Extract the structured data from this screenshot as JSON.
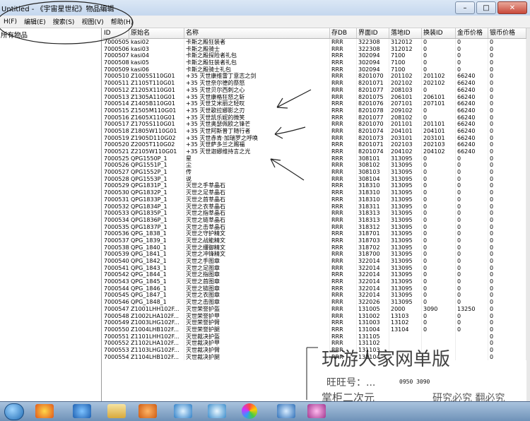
{
  "window": {
    "title": "Untitled - 《宇宙星世纪》物品编辑"
  },
  "menu": [
    "H(F)",
    "编辑(E)",
    "搜索(S)",
    "视图(V)",
    "帮助(H)"
  ],
  "tree": {
    "root_label": "所有物品"
  },
  "columns": [
    "ID",
    "原始名",
    "名称",
    "存DB",
    "界面ID",
    "落地ID",
    "换装ID",
    "金币价格",
    "银币价格"
  ],
  "rows": [
    [
      "7000505",
      "kasi02",
      "卡斯之殿狂装者",
      "RRR",
      "322308",
      "312012",
      "0",
      "0",
      "0"
    ],
    [
      "7000506",
      "kasi03",
      "卡斯之殿骑士",
      "RRR",
      "322308",
      "312012",
      "0",
      "0",
      "0"
    ],
    [
      "7000507",
      "kasi04",
      "卡斯之殿探险者礼包",
      "RRR",
      "302094",
      "7100",
      "0",
      "0",
      "0"
    ],
    [
      "7000508",
      "kasi05",
      "卡斯之殿狂装者礼包",
      "RRR",
      "302094",
      "7100",
      "0",
      "0",
      "0"
    ],
    [
      "7000509",
      "kasi06",
      "卡斯之殿骑士礼包",
      "RRR",
      "302094",
      "7100",
      "0",
      "0",
      "0"
    ],
    [
      "7000510",
      "Z1005S110G01",
      "+35 灭世康维雷丁意志之剑",
      "RRR",
      "8201070",
      "201102",
      "201102",
      "66240",
      "0"
    ],
    [
      "7000511",
      "Z1105T110G01",
      "+35 灭世奈尔德的祭怒",
      "RRR",
      "8201071",
      "202102",
      "202102",
      "66240",
      "0"
    ],
    [
      "7000512",
      "Z1205X110G01",
      "+35 灭世贝尔西刺之心",
      "RRR",
      "8201077",
      "208103",
      "0",
      "66240",
      "0"
    ],
    [
      "7000513",
      "Z1305A110G01",
      "+35 灭世康格狂怒之斩",
      "RRR",
      "8201075",
      "206101",
      "206101",
      "66240",
      "0"
    ],
    [
      "7000514",
      "Z1405B110G01",
      "+35 灭世艾米丽之轻叹",
      "RRR",
      "8201076",
      "207101",
      "207101",
      "66240",
      "0"
    ],
    [
      "7000515",
      "Z1505M110G01",
      "+35 灭世歌拉娜影之刃",
      "RRR",
      "8201078",
      "209102",
      "0",
      "66240",
      "0"
    ],
    [
      "7000516",
      "Z1605X110G01",
      "+35 灭世凯乐妮的微笑",
      "RRR",
      "8201077",
      "208102",
      "0",
      "66240",
      "0"
    ],
    [
      "7000517",
      "Z1705S110G01",
      "+35 灭世奥瑟佩欧之锋芒",
      "RRR",
      "8201070",
      "201101",
      "201101",
      "66240",
      "0"
    ],
    [
      "7000518",
      "Z1805W110G01",
      "+35 灭世阿斯普丁随行者",
      "RRR",
      "8201074",
      "204101",
      "204101",
      "66240",
      "0"
    ],
    [
      "7000519",
      "Z1905D110G02",
      "+35 灭世赤肯·加瑞罗之呼唤",
      "RRR",
      "8201073",
      "203101",
      "203101",
      "66240",
      "0"
    ],
    [
      "7000520",
      "Z2005T110G02",
      "+35 灭世萨多兰之赐福",
      "RRR",
      "8201071",
      "202103",
      "202103",
      "66240",
      "0"
    ],
    [
      "7000521",
      "Z2105W110G01",
      "+35 灭世迦娜维持言之光",
      "RRR",
      "8201074",
      "204102",
      "204102",
      "66240",
      "0"
    ],
    [
      "7000525",
      "QPG1550P_1",
      "星",
      "RRR",
      "308101",
      "313095",
      "0",
      "0",
      "0"
    ],
    [
      "7000526",
      "QPG1551P_1",
      "尘",
      "RRR",
      "308102",
      "313095",
      "0",
      "0",
      "0"
    ],
    [
      "7000527",
      "QPG1552P_1",
      "传",
      "RRR",
      "308103",
      "313095",
      "0",
      "0",
      "0"
    ],
    [
      "7000528",
      "QPG1553P_1",
      "说",
      "RRR",
      "308104",
      "313095",
      "0",
      "0",
      "0"
    ],
    [
      "7000529",
      "QPG1831P_1",
      "灭世之手莘晶石",
      "RRR",
      "318310",
      "313095",
      "0",
      "0",
      "0"
    ],
    [
      "7000530",
      "QPG1832P_1",
      "灭世之足莘晶石",
      "RRR",
      "318310",
      "313095",
      "0",
      "0",
      "0"
    ],
    [
      "7000531",
      "QPG1833P_1",
      "灭世之首莘晶石",
      "RRR",
      "318310",
      "313095",
      "0",
      "0",
      "0"
    ],
    [
      "7000532",
      "QPG1834P_1",
      "灭世之衣莘晶石",
      "RRR",
      "318311",
      "313095",
      "0",
      "0",
      "0"
    ],
    [
      "7000533",
      "QPG1835P_1",
      "灭世之指莘晶石",
      "RRR",
      "318313",
      "313095",
      "0",
      "0",
      "0"
    ],
    [
      "7000534",
      "QPG1836P_1",
      "灭世之链莘晶石",
      "RRR",
      "318313",
      "313095",
      "0",
      "0",
      "0"
    ],
    [
      "7000535",
      "QPG1837P_1",
      "灭世之击莘晶石",
      "RRR",
      "318312",
      "313095",
      "0",
      "0",
      "0"
    ],
    [
      "7000536",
      "QPG_1838_1",
      "灭世之守护精文",
      "RRR",
      "318701",
      "313095",
      "0",
      "0",
      "0"
    ],
    [
      "7000537",
      "QPG_1839_1",
      "灭世之战能精文",
      "RRR",
      "318703",
      "313095",
      "0",
      "0",
      "0"
    ],
    [
      "7000538",
      "QPG_1840_1",
      "灭世之缰御精文",
      "RRR",
      "318702",
      "313095",
      "0",
      "0",
      "0"
    ],
    [
      "7000539",
      "QPG_1841_1",
      "灭世之冲锋精文",
      "RRR",
      "318700",
      "313095",
      "0",
      "0",
      "0"
    ],
    [
      "7000540",
      "QPG_1842_1",
      "灭世之手图章",
      "RRR",
      "322014",
      "313095",
      "0",
      "0",
      "0"
    ],
    [
      "7000541",
      "QPG_1843_1",
      "灭世之足图章",
      "RRR",
      "322014",
      "313095",
      "0",
      "0",
      "0"
    ],
    [
      "7000542",
      "QPG_1844_1",
      "灭世之指图章",
      "RRR",
      "322014",
      "313095",
      "0",
      "0",
      "0"
    ],
    [
      "7000543",
      "QPG_1845_1",
      "灭世之首图章",
      "RRR",
      "322014",
      "313095",
      "0",
      "0",
      "0"
    ],
    [
      "7000544",
      "QPG_1846_1",
      "灭世之链图章",
      "RRR",
      "322014",
      "313095",
      "0",
      "0",
      "0"
    ],
    [
      "7000545",
      "QPG_1847_1",
      "灭世之衣图章",
      "RRR",
      "322014",
      "313095",
      "0",
      "0",
      "0"
    ],
    [
      "7000546",
      "QPG_1848_1",
      "灭世之击图章",
      "RRR",
      "322026",
      "313095",
      "0",
      "0",
      "0"
    ],
    [
      "7000547",
      "Z1001LHH102F...",
      "灭世荣誉护盔",
      "RRR",
      "131005",
      "2000",
      "3090",
      "13250",
      "0"
    ],
    [
      "7000548",
      "Z1002LHA102F...",
      "灭世荣誉护甲",
      "RRR",
      "131002",
      "13103",
      "0",
      "0",
      "0"
    ],
    [
      "7000549",
      "Z1003LHG102F...",
      "灭世荣誉护臂",
      "RRR",
      "131003",
      "13102",
      "0",
      "0",
      "0"
    ],
    [
      "7000550",
      "Z1004LHB102F...",
      "灭世荣誉护腿",
      "RRR",
      "131004",
      "13104",
      "0",
      "0",
      "0"
    ],
    [
      "7000551",
      "Z1101LHH102F...",
      "灭世裁决护盔",
      "RRR",
      "131105",
      "",
      "",
      "",
      "0"
    ],
    [
      "7000552",
      "Z1102LHA102F...",
      "灭世裁决护甲",
      "RRR",
      "131102",
      "",
      "",
      "",
      "0"
    ],
    [
      "7000553",
      "Z1103LHG102F...",
      "灭世裁决护臂",
      "RRR",
      "131103",
      "",
      "",
      "",
      "0"
    ],
    [
      "7000554",
      "Z1104LHB102F...",
      "灭世裁决护腿",
      "RRR",
      "131104",
      "",
      "",
      "",
      "0"
    ]
  ],
  "watermark": {
    "line1": "玩游人家网单版",
    "line2": "旺旺号：...",
    "line3": "掌柜二次元",
    "corner": "研究必究 翻必究",
    "small": "0950  3090"
  },
  "taskbar_icons": [
    "start-orb",
    "qq-icon",
    "ie-icon",
    "explorer-icon",
    "media-player-icon",
    "app-p-icon",
    "app-sync-icon",
    "color-wheel-icon",
    "search-app-icon",
    "game-icon"
  ]
}
